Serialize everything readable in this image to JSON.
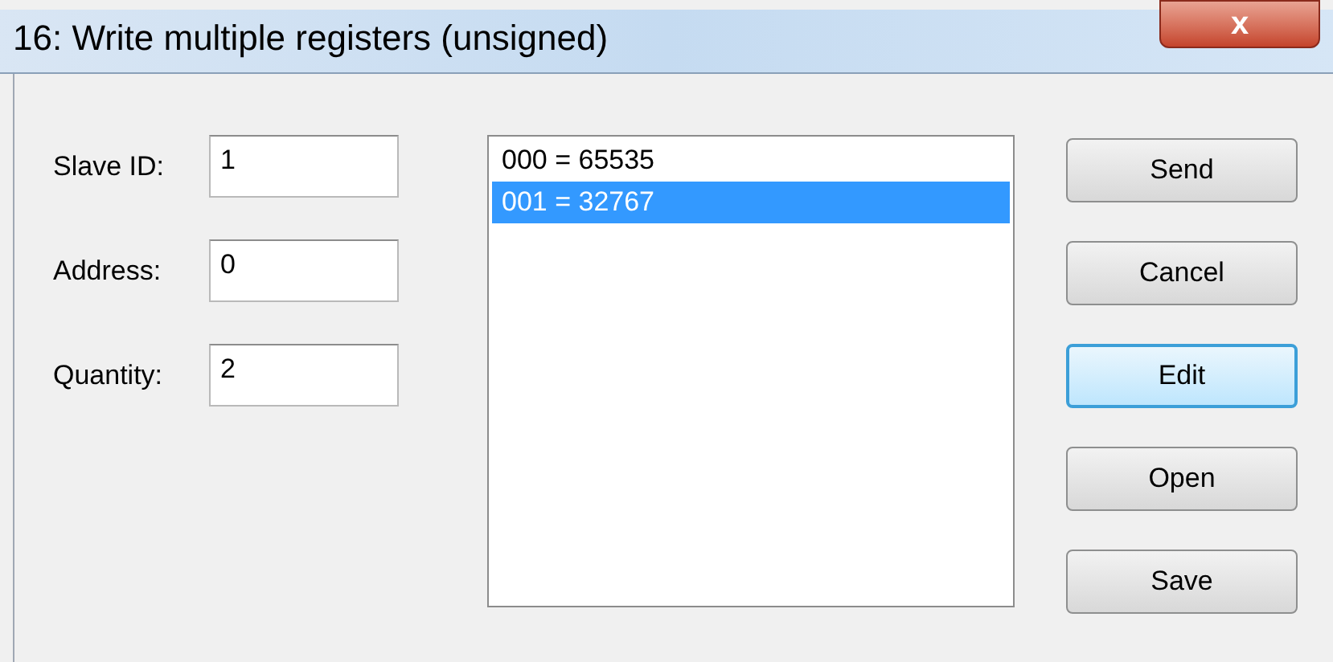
{
  "window": {
    "title": "16: Write multiple registers (unsigned)",
    "close_icon": "x"
  },
  "fields": [
    {
      "label": "Slave ID:",
      "value": "1"
    },
    {
      "label": "Address:",
      "value": "0"
    },
    {
      "label": "Quantity:",
      "value": "2"
    }
  ],
  "list": {
    "items": [
      {
        "text": "000 = 65535",
        "selected": false
      },
      {
        "text": "001 = 32767",
        "selected": true
      }
    ]
  },
  "buttons": [
    {
      "label": "Send",
      "focused": false
    },
    {
      "label": "Cancel",
      "focused": false
    },
    {
      "label": "Edit",
      "focused": true
    },
    {
      "label": "Open",
      "focused": false
    },
    {
      "label": "Save",
      "focused": false
    }
  ]
}
